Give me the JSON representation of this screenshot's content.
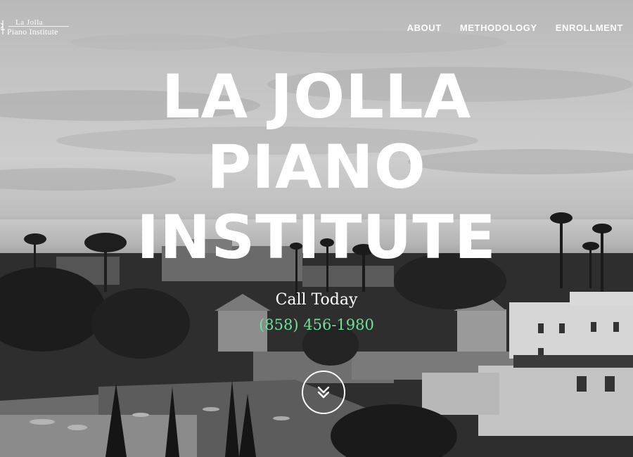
{
  "logo": {
    "line1": "La  Jolla",
    "line2": "Piano Institute"
  },
  "nav": {
    "items": [
      "ABOUT",
      "METHODOLOGY",
      "ENROLLMENT"
    ]
  },
  "hero": {
    "title_lines": [
      "LA JOLLA",
      "PIANO",
      "INSTITUTE"
    ],
    "call_label": "Call Today",
    "phone": "(858) 456-1980",
    "phone_color": "#6fe09a"
  },
  "icons": {
    "scroll": "double-chevron-down-icon",
    "logo_mark": "piano-key-icon"
  }
}
